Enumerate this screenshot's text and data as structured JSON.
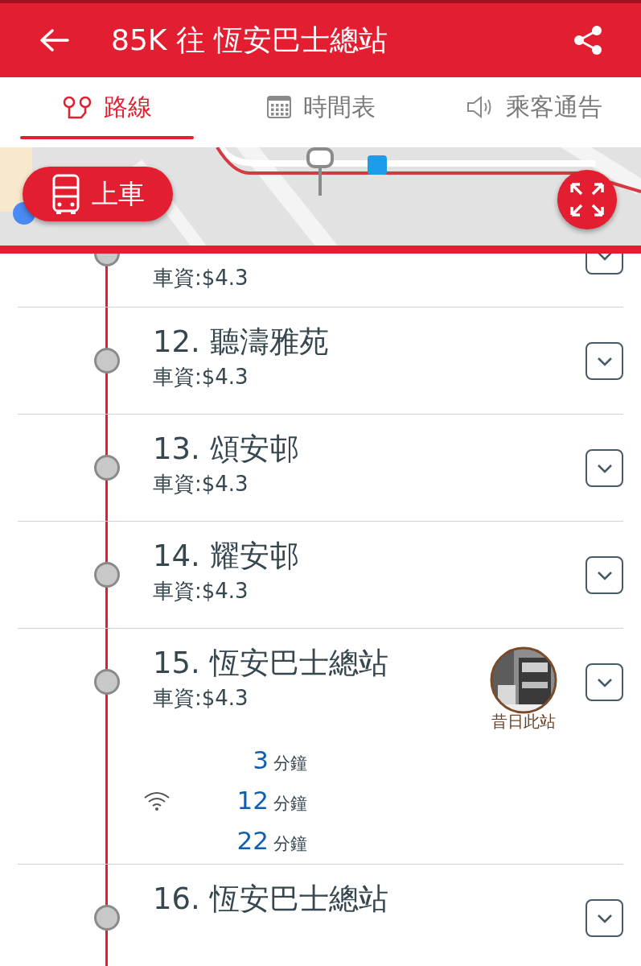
{
  "header": {
    "title": "85K 往 恆安巴士總站"
  },
  "tabs": [
    {
      "label": "路線",
      "kind": "route",
      "selected": true
    },
    {
      "label": "時間表",
      "kind": "calendar",
      "selected": false
    },
    {
      "label": "乘客通告",
      "kind": "speaker",
      "selected": false
    }
  ],
  "map": {
    "kind": "picture",
    "board_button": {
      "label": "上車"
    }
  },
  "stops": [
    {
      "fare": "車資:$4.3"
    },
    {
      "name": "12. 聽濤雅苑",
      "fare": "車資:$4.3"
    },
    {
      "name": "13. 頌安邨",
      "fare": "車資:$4.3"
    },
    {
      "name": "14. 耀安邨",
      "fare": "車資:$4.3"
    },
    {
      "name": "15. 恆安巴士總站",
      "fare": "車資:$4.3",
      "old_photo": {
        "label": "昔日此站"
      },
      "etas": [
        {
          "minutes": "3",
          "unit": "分鐘"
        },
        {
          "minutes": "12",
          "unit": "分鐘"
        },
        {
          "minutes": "22",
          "unit": "分鐘"
        }
      ]
    },
    {
      "name": "16. 恆安巴士總站"
    }
  ]
}
